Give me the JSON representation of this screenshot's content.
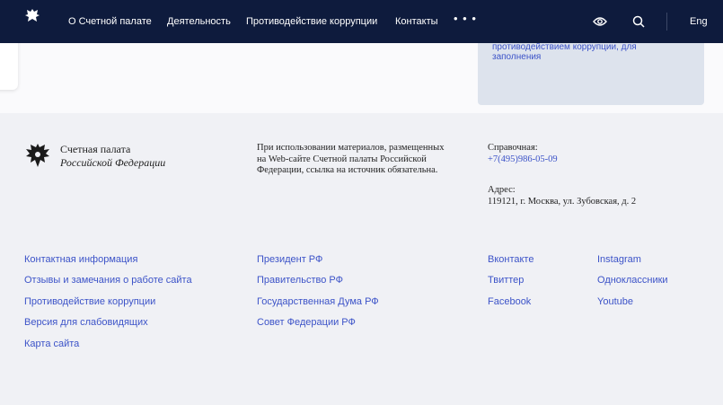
{
  "header": {
    "nav": [
      {
        "label": "О Счетной палате"
      },
      {
        "label": "Деятельность"
      },
      {
        "label": "Противодействие коррупции"
      },
      {
        "label": "Контакты"
      }
    ],
    "more": "• • •",
    "lang": "Eng"
  },
  "docs_card": {
    "text": "Формы документов, связанных с противодействием коррупции, для заполнения"
  },
  "footer": {
    "org": {
      "line1": "Счетная палата",
      "line2": "Российской Федерации"
    },
    "copyright": "При использовании материалов, размещенных на Web-сайте Счетной палаты Российской Федерации, ссылка на источник обязательна.",
    "phone_label": "Справочная:",
    "phone": "+7(495)986-05-09",
    "address_label": "Адрес:",
    "address": "119121, г. Москва, ул. Зубовская, д. 2",
    "col1": [
      "Контактная информация",
      "Отзывы и замечания о работе сайта",
      "Противодействие коррупции",
      "Версия для слабовидящих",
      "Карта сайта"
    ],
    "col2": [
      "Президент РФ",
      "Правительство РФ",
      "Государственная Дума РФ",
      "Совет Федерации РФ"
    ],
    "col3": [
      "Вконтакте",
      "Твиттер",
      "Facebook"
    ],
    "col4": [
      "Instagram",
      "Одноклассники",
      "Youtube"
    ]
  },
  "colors": {
    "header_bg": "#0e1b3d",
    "link": "#3c53c8",
    "footer_bg": "#f0f1f5"
  },
  "icons": [
    "emblem-icon",
    "eye-icon",
    "search-icon"
  ]
}
